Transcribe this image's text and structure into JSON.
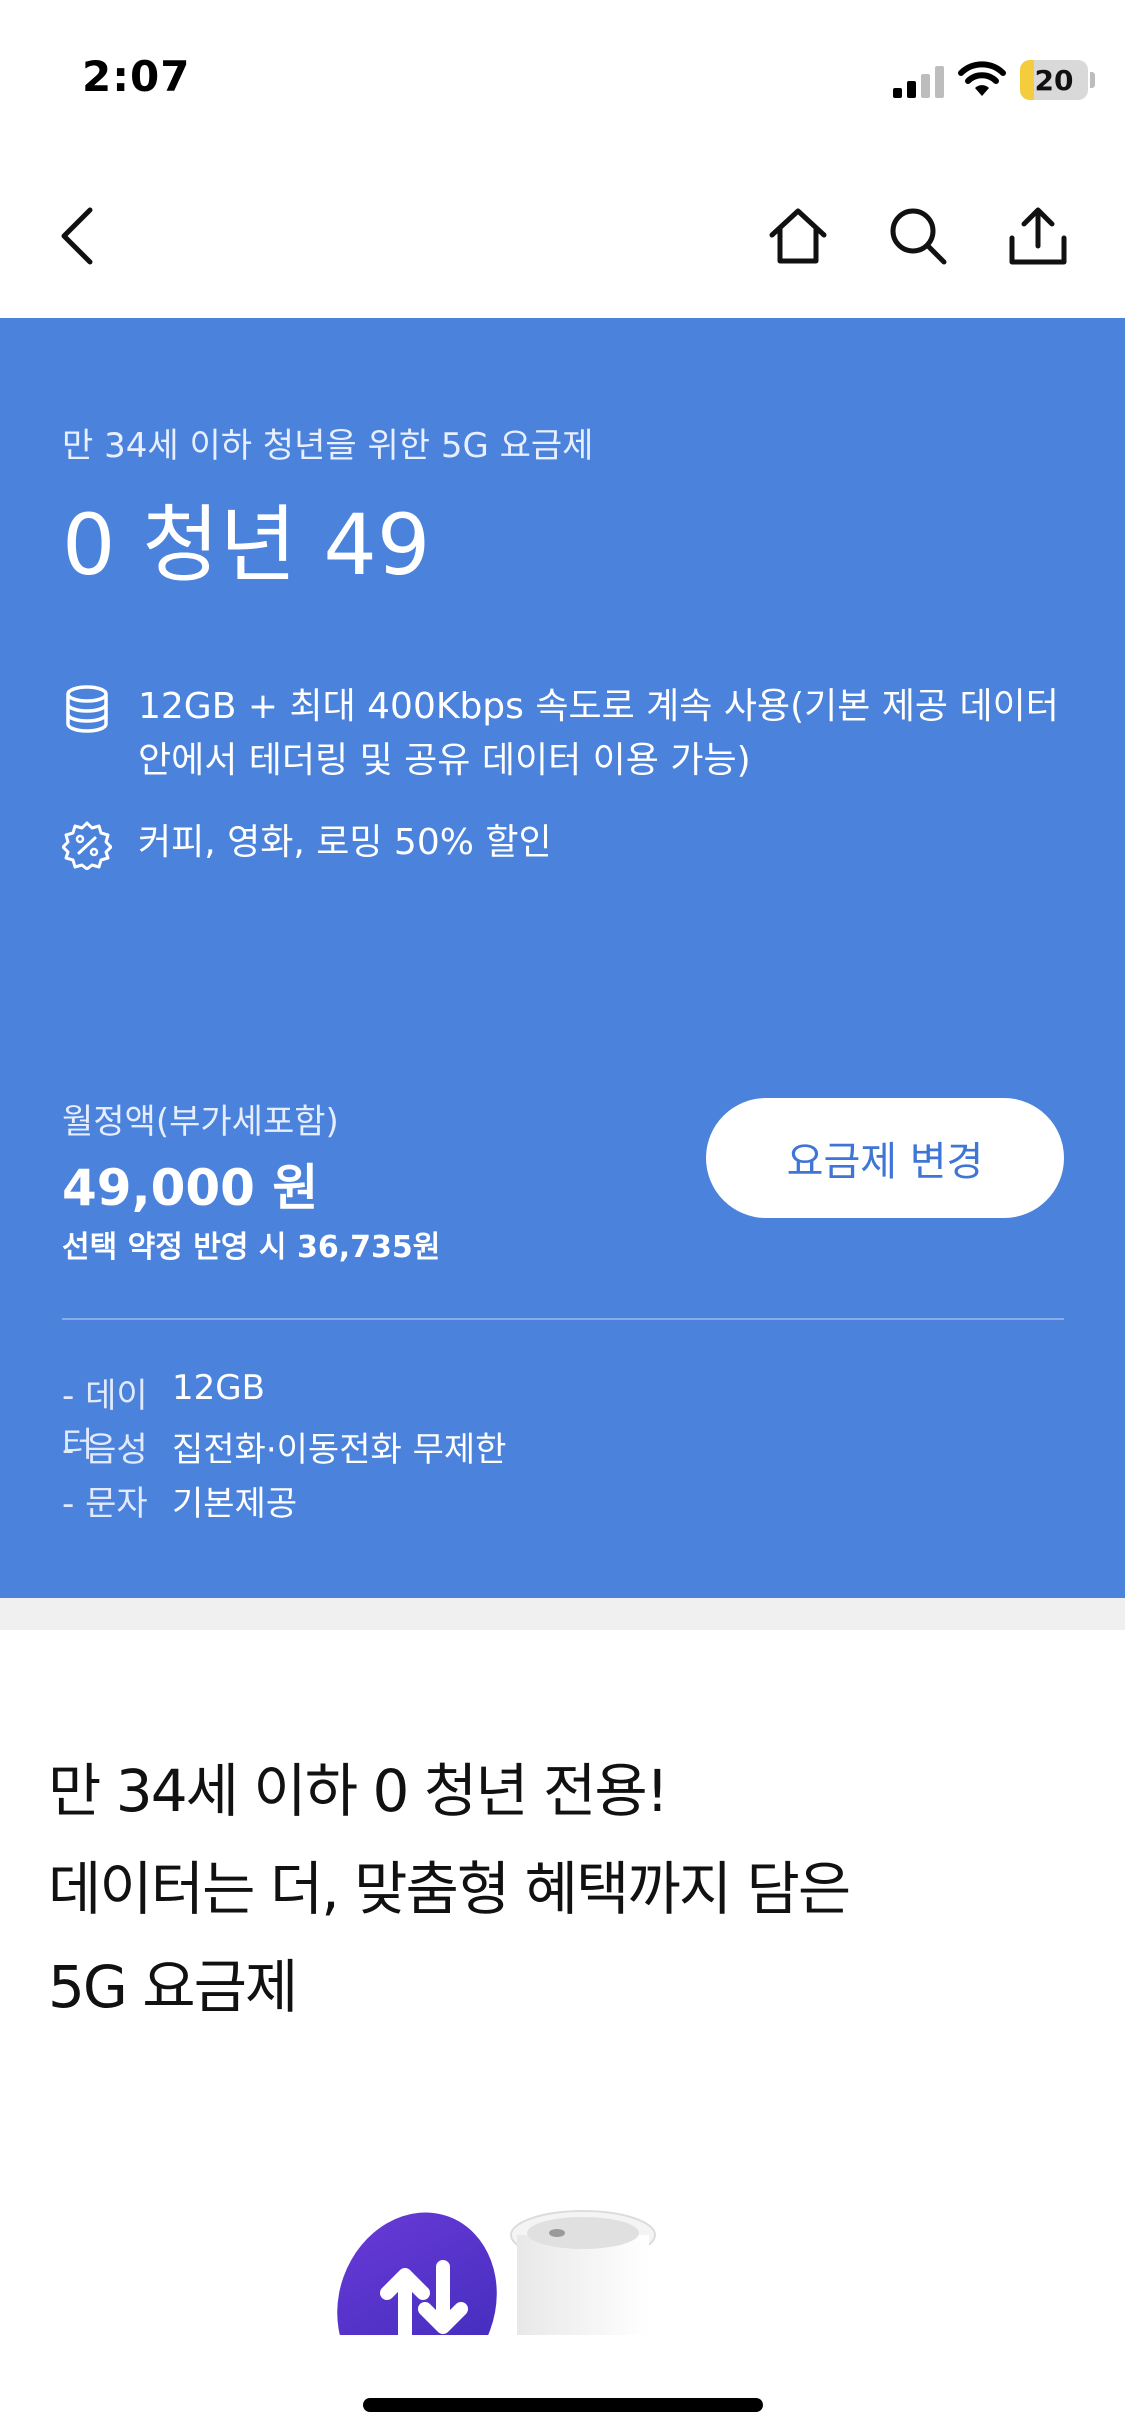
{
  "status_bar": {
    "time": "2:07",
    "battery_level": "20",
    "battery_percent": 20,
    "icons": [
      "signal-icon",
      "wifi-icon",
      "battery-icon"
    ]
  },
  "nav": {
    "icons": [
      "back-icon",
      "home-icon",
      "search-icon",
      "share-icon"
    ]
  },
  "hero": {
    "background": "#4a82dc",
    "subtitle": "만 34세 이하 청년을 위한 5G 요금제",
    "title": "0 청년 49",
    "features": [
      {
        "icon": "database-icon",
        "text": "12GB + 최대 400Kbps 속도로 계속 사용(기본 제공 데이터 안에서 테더링 및 공유 데이터 이용 가능)"
      },
      {
        "icon": "discount-badge-icon",
        "text": "커피, 영화, 로밍 50% 할인"
      }
    ],
    "price_label": "월정액(부가세포함)",
    "price": "49,000 원",
    "discount_price": "선택 약정 반영 시 36,735원",
    "change_button": "요금제 변경",
    "specs": [
      {
        "name": "- 데이터",
        "value": "12GB"
      },
      {
        "name": "- 음성",
        "value": "집전화·이동전화 무제한"
      },
      {
        "name": "- 문자",
        "value": "기본제공"
      }
    ]
  },
  "promo": {
    "lines": [
      "만 34세 이하 0 청년 전용!",
      "데이터는 더, 맞춤형 혜택까지 담은",
      "5G 요금제"
    ]
  },
  "illustration": {
    "icons": [
      "data-arrows-icon",
      "coffee-cup-icon"
    ]
  }
}
